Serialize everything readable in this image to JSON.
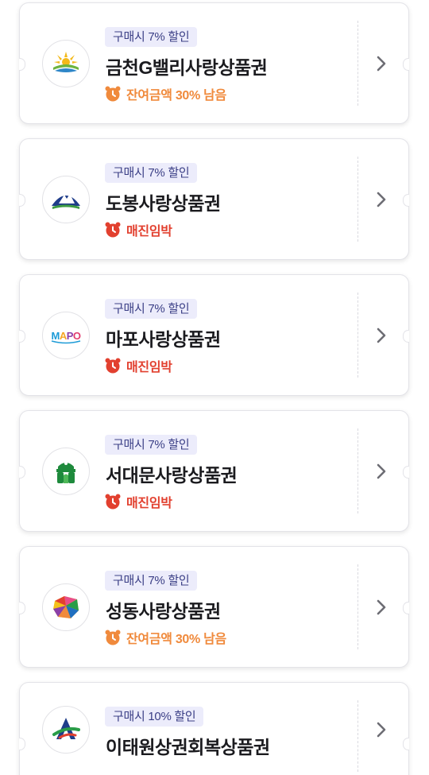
{
  "vouchers": [
    {
      "badge": "구매시 7% 할인",
      "title": "금천G밸리사랑상품권",
      "status": "잔여금액 30% 남음",
      "status_type": "orange",
      "logo": "geumcheon-logo"
    },
    {
      "badge": "구매시 7% 할인",
      "title": "도봉사랑상품권",
      "status": "매진임박",
      "status_type": "red",
      "logo": "dobong-logo"
    },
    {
      "badge": "구매시 7% 할인",
      "title": "마포사랑상품권",
      "status": "매진임박",
      "status_type": "red",
      "logo": "mapo-logo",
      "logo_text": "MAPO"
    },
    {
      "badge": "구매시 7% 할인",
      "title": "서대문사랑상품권",
      "status": "매진임박",
      "status_type": "red",
      "logo": "seodaemun-logo"
    },
    {
      "badge": "구매시 7% 할인",
      "title": "성동사랑상품권",
      "status": "잔여금액 30% 남음",
      "status_type": "orange",
      "logo": "seongdong-logo"
    },
    {
      "badge": "구매시 10% 할인",
      "title": "이태원상권회복상품권",
      "status": "",
      "status_type": "none",
      "logo": "itaewon-logo"
    }
  ],
  "colors": {
    "badge_bg": "#ececfb",
    "badge_text": "#3b3f86",
    "status_orange": "#f08a3c",
    "status_red": "#e2402f",
    "title_text": "#1b1b1f"
  },
  "icons": {
    "status": "alarm-clock-icon",
    "action": "chevron-right-icon"
  }
}
